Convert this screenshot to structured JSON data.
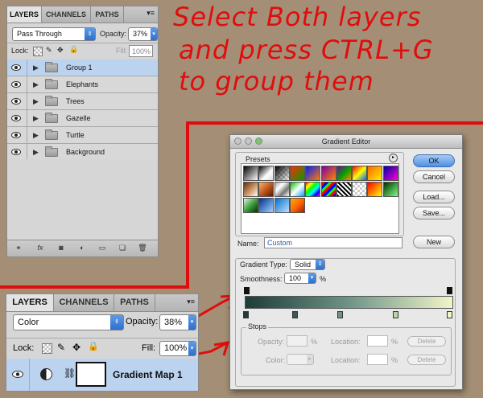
{
  "annotation": {
    "line1": "Select Both layers",
    "line2": "and press CTRL+G",
    "line3": "to group them"
  },
  "layers_panel_top": {
    "tabs": [
      "LAYERS",
      "CHANNELS",
      "PATHS"
    ],
    "blend_mode": "Pass Through",
    "opacity_label": "Opacity:",
    "opacity_value": "37%",
    "lock_label": "Lock:",
    "fill_label": "Fill:",
    "fill_value": "100%",
    "layers": [
      {
        "name": "Group 1",
        "selected": true
      },
      {
        "name": "Elephants",
        "selected": false
      },
      {
        "name": "Trees",
        "selected": false
      },
      {
        "name": "Gazelle",
        "selected": false
      },
      {
        "name": "Turtle",
        "selected": false
      },
      {
        "name": "Background",
        "selected": false
      }
    ],
    "footer_icons": [
      "link-icon",
      "fx-icon",
      "mask-icon",
      "adjustment-icon",
      "folder-icon",
      "new-layer-icon",
      "trash-icon"
    ]
  },
  "layers_panel_bottom": {
    "tabs": [
      "LAYERS",
      "CHANNELS",
      "PATHS"
    ],
    "blend_mode": "Color",
    "opacity_label": "Opacity:",
    "opacity_value": "38%",
    "lock_label": "Lock:",
    "fill_label": "Fill:",
    "fill_value": "100%",
    "layer_name": "Gradient Map 1"
  },
  "gradient_editor": {
    "title": "Gradient Editor",
    "presets_label": "Presets",
    "ok": "OK",
    "cancel": "Cancel",
    "load": "Load...",
    "save": "Save...",
    "name_label": "Name:",
    "name_value": "Custom",
    "new_label": "New",
    "gradient_type_label": "Gradient Type:",
    "gradient_type_value": "Solid",
    "smoothness_label": "Smoothness:",
    "smoothness_value": "100",
    "smoothness_unit": "%",
    "stops_label": "Stops",
    "opacity_label": "Opacity:",
    "color_label": "Color:",
    "location_label": "Location:",
    "percent": "%",
    "delete_label": "Delete",
    "gradient_colors": [
      "#1e3c38",
      "#6e9488",
      "#f1f5c8"
    ]
  }
}
